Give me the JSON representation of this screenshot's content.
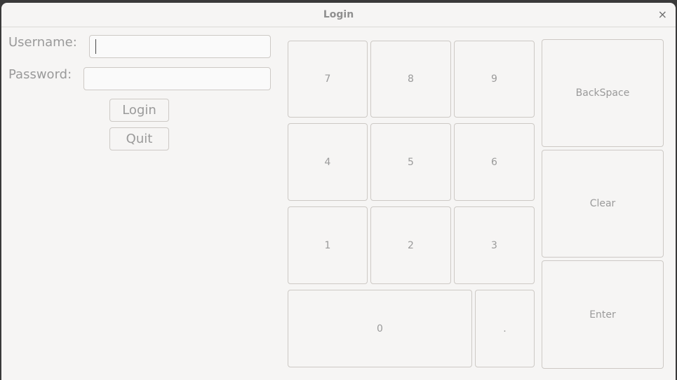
{
  "window": {
    "title": "Login",
    "close_glyph": "×"
  },
  "form": {
    "username_label": "Username:",
    "username_value": "",
    "password_label": "Password:",
    "password_value": "",
    "login_label": "Login",
    "quit_label": "Quit"
  },
  "keypad": {
    "keys": {
      "k7": "7",
      "k8": "8",
      "k9": "9",
      "k4": "4",
      "k5": "5",
      "k6": "6",
      "k1": "1",
      "k2": "2",
      "k3": "3",
      "k0": "0",
      "dot": "."
    },
    "backspace_label": "BackSpace",
    "clear_label": "Clear",
    "enter_label": "Enter"
  }
}
